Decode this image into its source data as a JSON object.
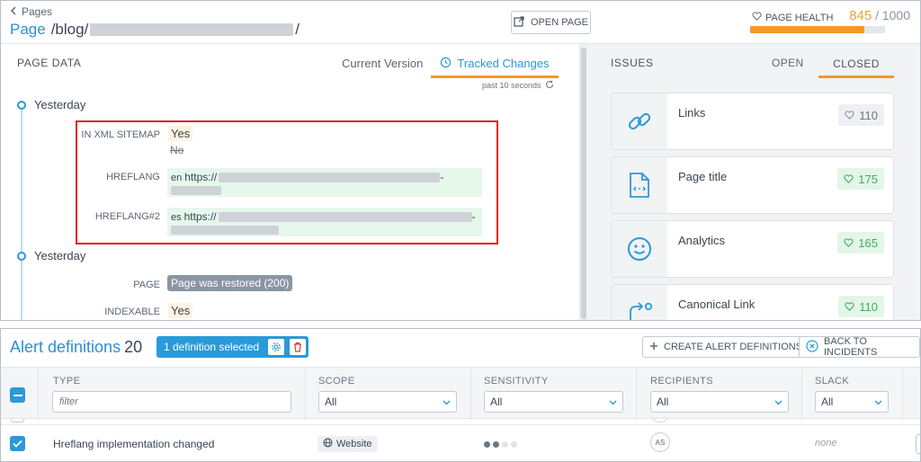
{
  "top": {
    "back_label": "Pages",
    "title_prefix": "Page",
    "title_path": "/blog/",
    "title_suffix": "/",
    "open_page_label": "OPEN PAGE",
    "health": {
      "label": "PAGE HEALTH",
      "score": "845",
      "max": "/ 1000",
      "fraction": 0.845,
      "color": "#f19a2a"
    },
    "page_data_title": "PAGE DATA",
    "tabs": {
      "current": "Current Version",
      "tracked": "Tracked Changes"
    },
    "refresh_note": "past 10 seconds",
    "timeline": [
      {
        "label": "Yesterday",
        "fields": {
          "xml_label": "IN XML SITEMAP",
          "xml_new": "Yes",
          "xml_old": "No",
          "hreflang_label": "HREFLANG",
          "hreflang_lang": "en",
          "hreflang_url": "https://",
          "hreflang2_label": "HREFLANG#2",
          "hreflang2_lang": "es",
          "hreflang2_url": "https://"
        }
      },
      {
        "label": "Yesterday",
        "fields": {
          "page_label": "PAGE",
          "page_value": "Page was restored (200)",
          "indexable_label": "INDEXABLE",
          "indexable_value": "Yes"
        }
      }
    ],
    "issues": {
      "title": "ISSUES",
      "tab_open": "OPEN",
      "tab_closed": "CLOSED",
      "items": [
        {
          "name": "Links",
          "count": "110",
          "icon": "link-icon"
        },
        {
          "name": "Page title",
          "count": "175",
          "icon": "html-file-icon"
        },
        {
          "name": "Analytics",
          "count": "165",
          "icon": "smiley-icon"
        },
        {
          "name": "Canonical Link",
          "count": "110",
          "icon": "canonical-arrow-icon"
        }
      ]
    }
  },
  "bottom": {
    "title": "Alert definitions",
    "count": "20",
    "selected_badge": "1 definition selected",
    "create_btn": "CREATE ALERT DEFINITIONS",
    "back_btn": "BACK TO INCIDENTS",
    "columns": {
      "type": "TYPE",
      "scope": "SCOPE",
      "sensitivity": "SENSITIVITY",
      "recipients": "RECIPIENTS",
      "slack": "SLACK"
    },
    "filters": {
      "type_placeholder": "filter",
      "scope": "All",
      "sensitivity": "All",
      "recipients": "All",
      "slack": "All"
    },
    "row": {
      "type": "Hreflang implementation changed",
      "scope": "Website",
      "sensitivity_level": 2,
      "sensitivity_max": 4,
      "recipient": "AS",
      "slack": "none"
    }
  }
}
